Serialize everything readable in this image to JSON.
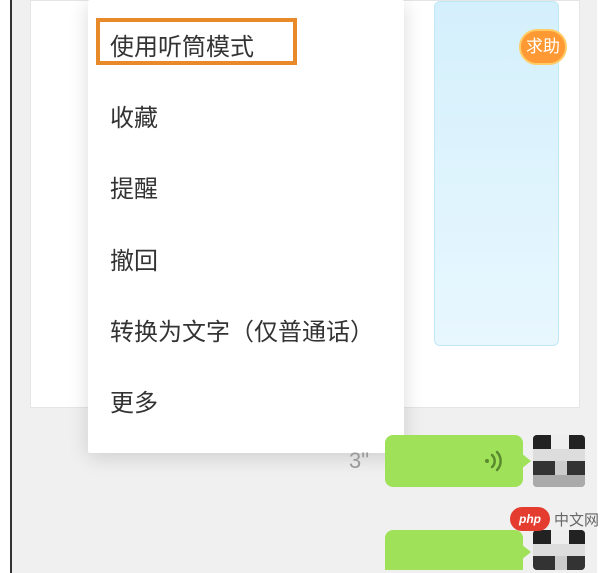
{
  "menu": {
    "items": [
      {
        "label": "使用听筒模式",
        "highlighted": true
      },
      {
        "label": "收藏",
        "highlighted": false
      },
      {
        "label": "提醒",
        "highlighted": false
      },
      {
        "label": "撤回",
        "highlighted": false
      },
      {
        "label": "转换为文字（仅普通话）",
        "highlighted": false
      },
      {
        "label": "更多",
        "highlighted": false
      }
    ]
  },
  "help_badge": {
    "label": "求助"
  },
  "voice_message": {
    "duration": "3\""
  },
  "watermark": {
    "logo": "php",
    "text": "中文网"
  }
}
